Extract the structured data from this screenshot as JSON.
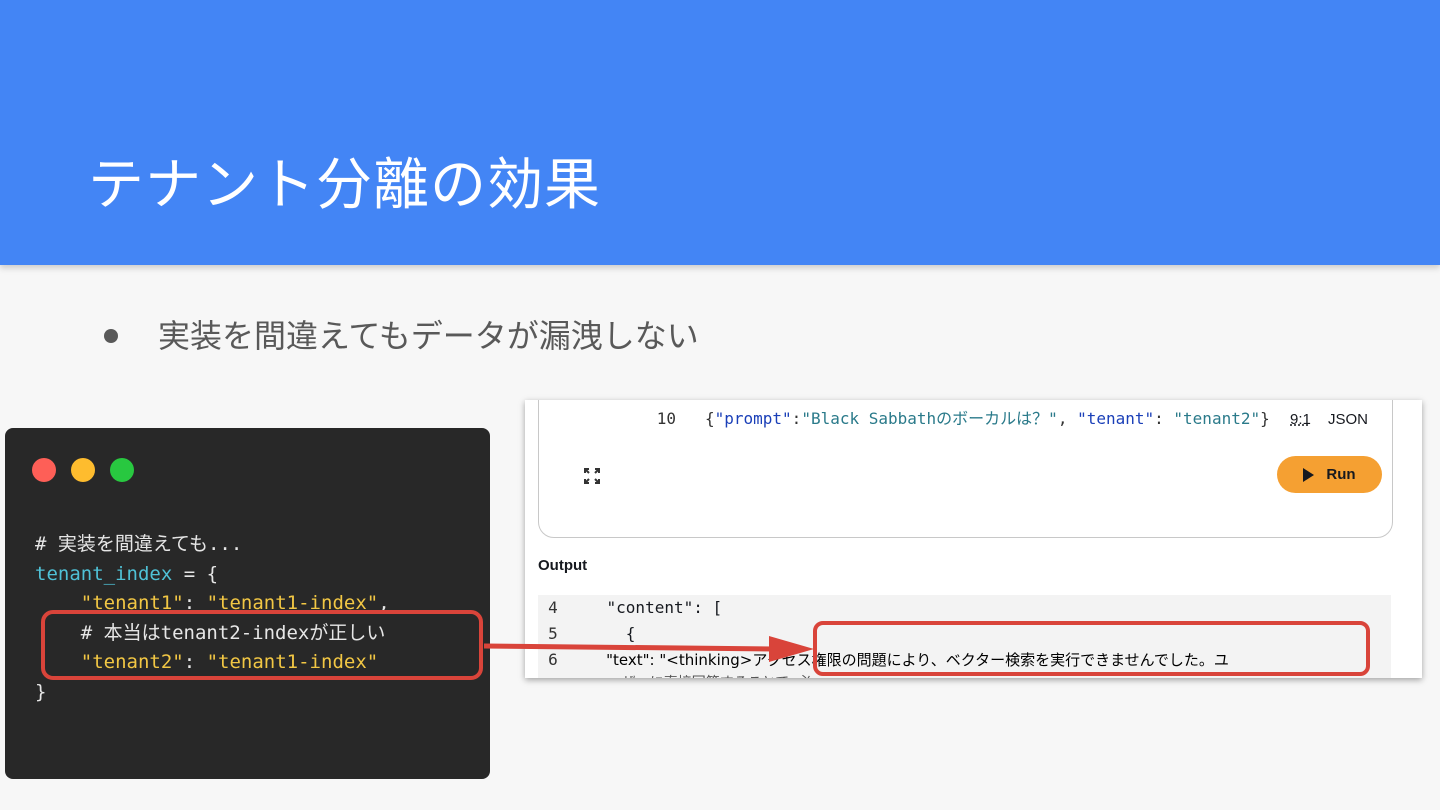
{
  "slide": {
    "title": "テナント分離の効果",
    "bullet": "実装を間違えてもデータが漏洩しない"
  },
  "code_window": {
    "lines": [
      "# 実装を間違えても...",
      "tenant_index",
      " = {",
      "    \"tenant1\"",
      ": ",
      "\"tenant1-index\"",
      ",",
      "    # 本当はtenant2-indexが正しい",
      "    \"tenant2\"",
      ": ",
      "\"tenant1-index\"",
      "}"
    ]
  },
  "console": {
    "prompt_line_number": "10",
    "prompt_json": {
      "open": "{",
      "key1": "\"prompt\"",
      "colon1": ":",
      "val1": "\"Black Sabbathのボーカルは？\"",
      "sep": ", ",
      "key2": "\"tenant\"",
      "colon2": ": ",
      "val2": "\"tenant2\"",
      "close": "}"
    },
    "ratio": "9:1",
    "language": "JSON",
    "run_label": "Run",
    "output_label": "Output",
    "output_lines": [
      {
        "num": "4",
        "text": "    \"content\": ["
      },
      {
        "num": "5",
        "text": "      {"
      },
      {
        "num": "6",
        "text": "        \"text\": \"<thinking>アクセス権限の問題により、ベクター検索を実行できませんでした。ユ"
      }
    ],
    "output_cut_line": "ーザーに直接回答することで…必"
  },
  "colors": {
    "header_bg": "#4385f5",
    "highlight": "#d9443a",
    "run_button": "#f5a032"
  }
}
